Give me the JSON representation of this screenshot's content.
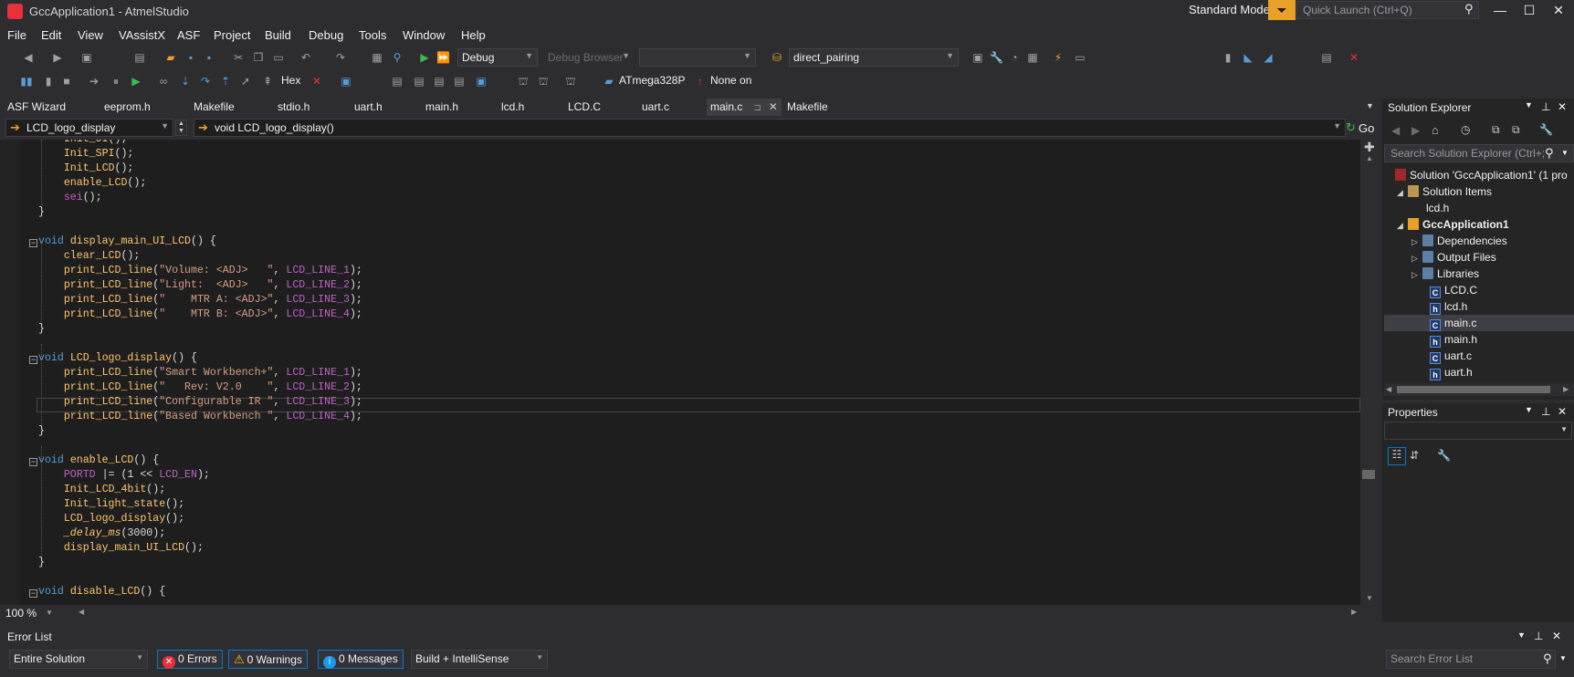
{
  "window": {
    "title": "GccApplication1 - AtmelStudio",
    "mode": "Standard Mode",
    "quick_launch_placeholder": "Quick Launch (Ctrl+Q)"
  },
  "menu": [
    "File",
    "Edit",
    "View",
    "VAssistX",
    "ASF",
    "Project",
    "Build",
    "Debug",
    "Tools",
    "Window",
    "Help"
  ],
  "toolbar": {
    "config": "Debug",
    "debug_browser": "Debug Browser",
    "find_combo": "direct_pairing",
    "hex_label": "Hex",
    "device": "ATmega328P",
    "tool": "None on"
  },
  "tabs": [
    "ASF Wizard",
    "eeprom.h",
    "Makefile",
    "stdio.h",
    "uart.h",
    "main.h",
    "lcd.h",
    "LCD.C",
    "uart.c",
    "main.c",
    "Makefile"
  ],
  "nav": {
    "scope": "LCD_logo_display",
    "member": "void LCD_logo_display()",
    "go": "Go"
  },
  "editor": {
    "zoom": "100 %"
  },
  "solution_explorer": {
    "title": "Solution Explorer",
    "search_placeholder": "Search Solution Explorer (Ctrl+;",
    "items": [
      {
        "label": "Solution 'GccApplication1' (1 pro"
      },
      {
        "label": "Solution Items"
      },
      {
        "label": "lcd.h"
      },
      {
        "label": "GccApplication1"
      },
      {
        "label": "Dependencies"
      },
      {
        "label": "Output Files"
      },
      {
        "label": "Libraries"
      },
      {
        "label": "LCD.C"
      },
      {
        "label": "lcd.h"
      },
      {
        "label": "main.c"
      },
      {
        "label": "main.h"
      },
      {
        "label": "uart.c"
      },
      {
        "label": "uart.h"
      }
    ]
  },
  "properties": {
    "title": "Properties"
  },
  "error_list": {
    "title": "Error List",
    "scope": "Entire Solution",
    "errors": "0 Errors",
    "warnings": "0 Warnings",
    "messages": "0 Messages",
    "source": "Build + IntelliSense",
    "search_placeholder": "Search Error List"
  }
}
